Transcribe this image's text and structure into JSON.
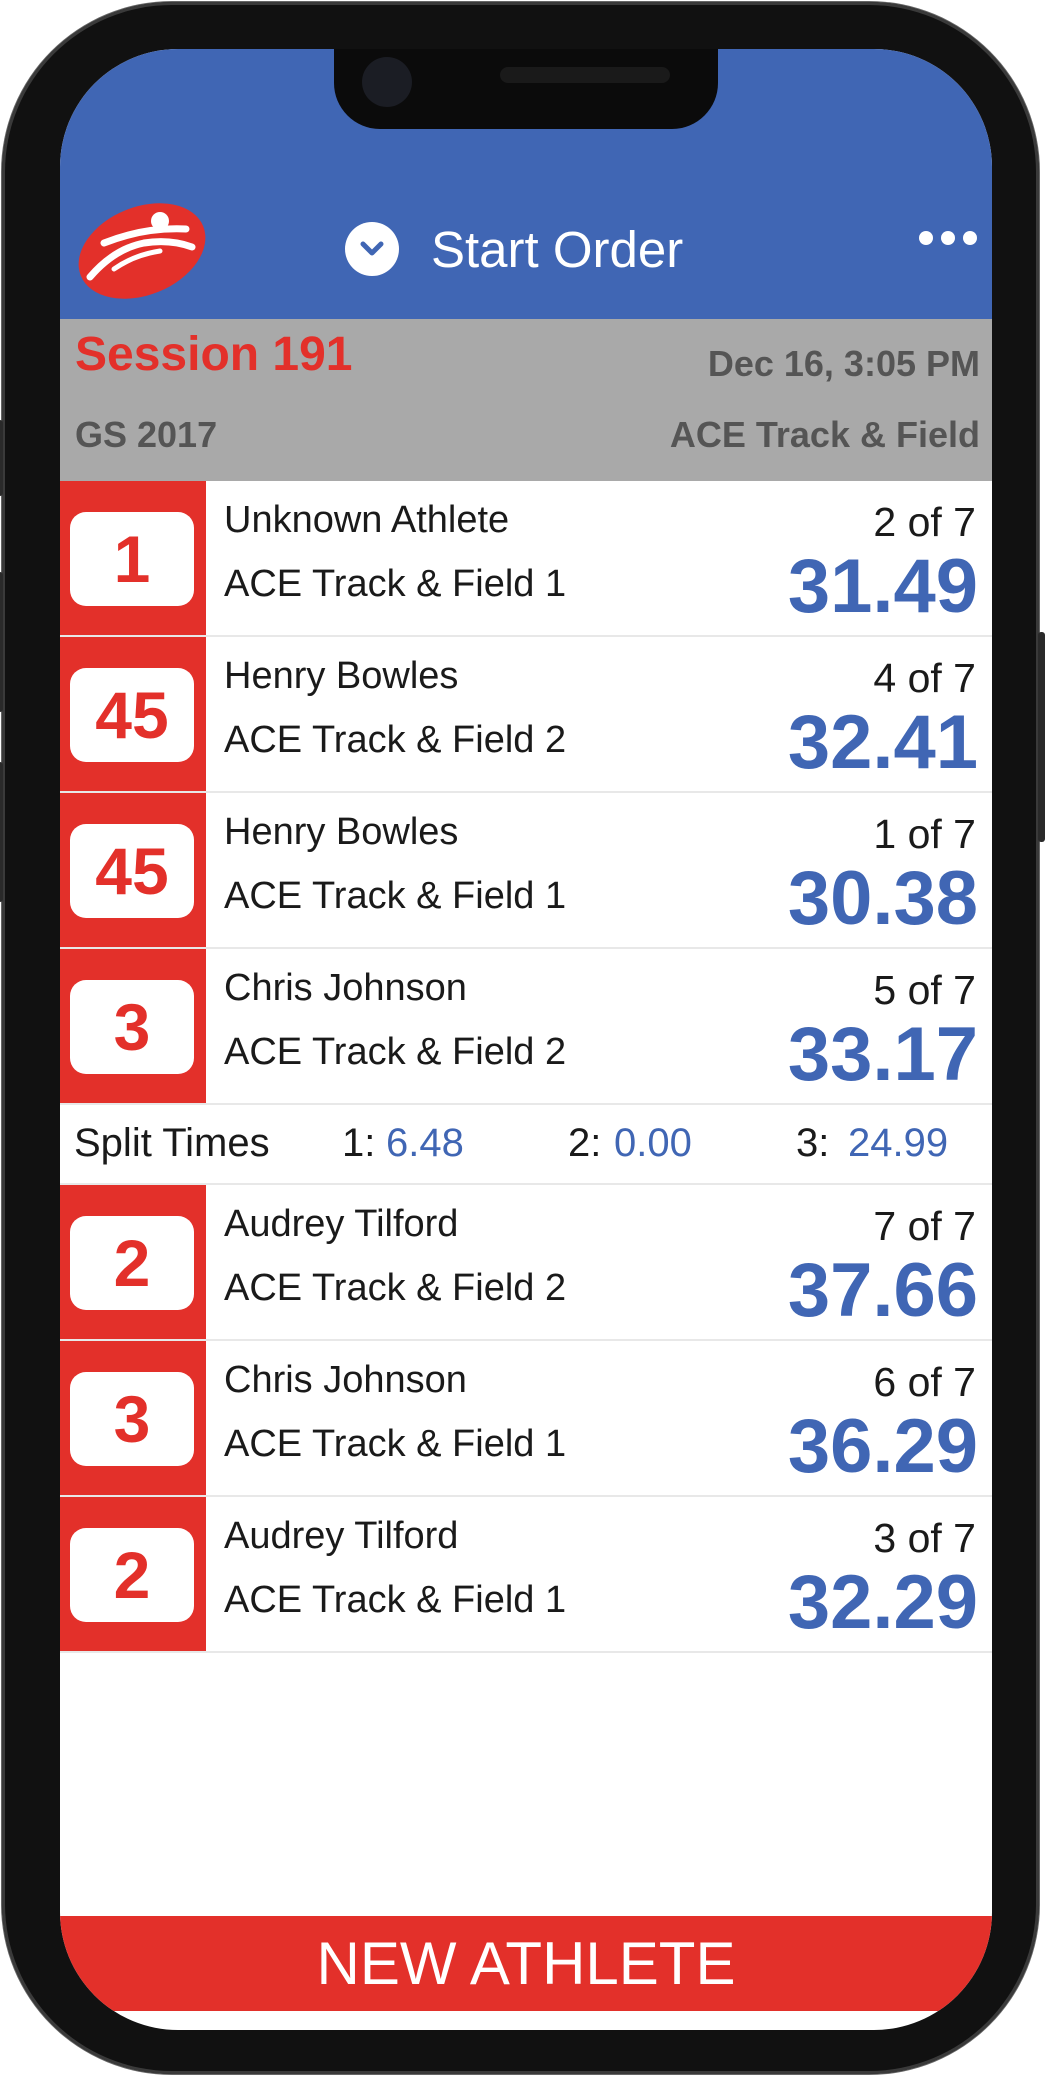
{
  "header": {
    "title": "Start Order",
    "colors": {
      "bar": "#4066b4",
      "accent": "#e3302a"
    }
  },
  "session": {
    "title": "Session 191",
    "datetime": "Dec 16, 3:05 PM",
    "meet": "GS 2017",
    "team": "ACE Track & Field"
  },
  "results": [
    {
      "lane": "1",
      "name": "Unknown Athlete",
      "team": "ACE Track & Field 1",
      "place": "2 of 7",
      "time": "31.49"
    },
    {
      "lane": "45",
      "name": "Henry Bowles",
      "team": "ACE Track & Field 2",
      "place": "4 of 7",
      "time": "32.41"
    },
    {
      "lane": "45",
      "name": "Henry Bowles",
      "team": "ACE Track & Field 1",
      "place": "1 of 7",
      "time": "30.38"
    },
    {
      "lane": "3",
      "name": "Chris Johnson",
      "team": "ACE Track & Field 2",
      "place": "5 of 7",
      "time": "33.17"
    },
    {
      "lane": "2",
      "name": "Audrey Tilford",
      "team": "ACE Track & Field 2",
      "place": "7 of 7",
      "time": "37.66"
    },
    {
      "lane": "3",
      "name": "Chris Johnson",
      "team": "ACE Track & Field 1",
      "place": "6 of 7",
      "time": "36.29"
    },
    {
      "lane": "2",
      "name": "Audrey Tilford",
      "team": "ACE Track & Field 1",
      "place": "3 of 7",
      "time": "32.29"
    }
  ],
  "splits": {
    "label": "Split Times",
    "items": [
      {
        "key": "1:",
        "value": "6.48"
      },
      {
        "key": "2:",
        "value": "0.00"
      },
      {
        "key": "3:",
        "value": "24.99"
      }
    ]
  },
  "footer": {
    "button": "NEW ATHLETE"
  }
}
